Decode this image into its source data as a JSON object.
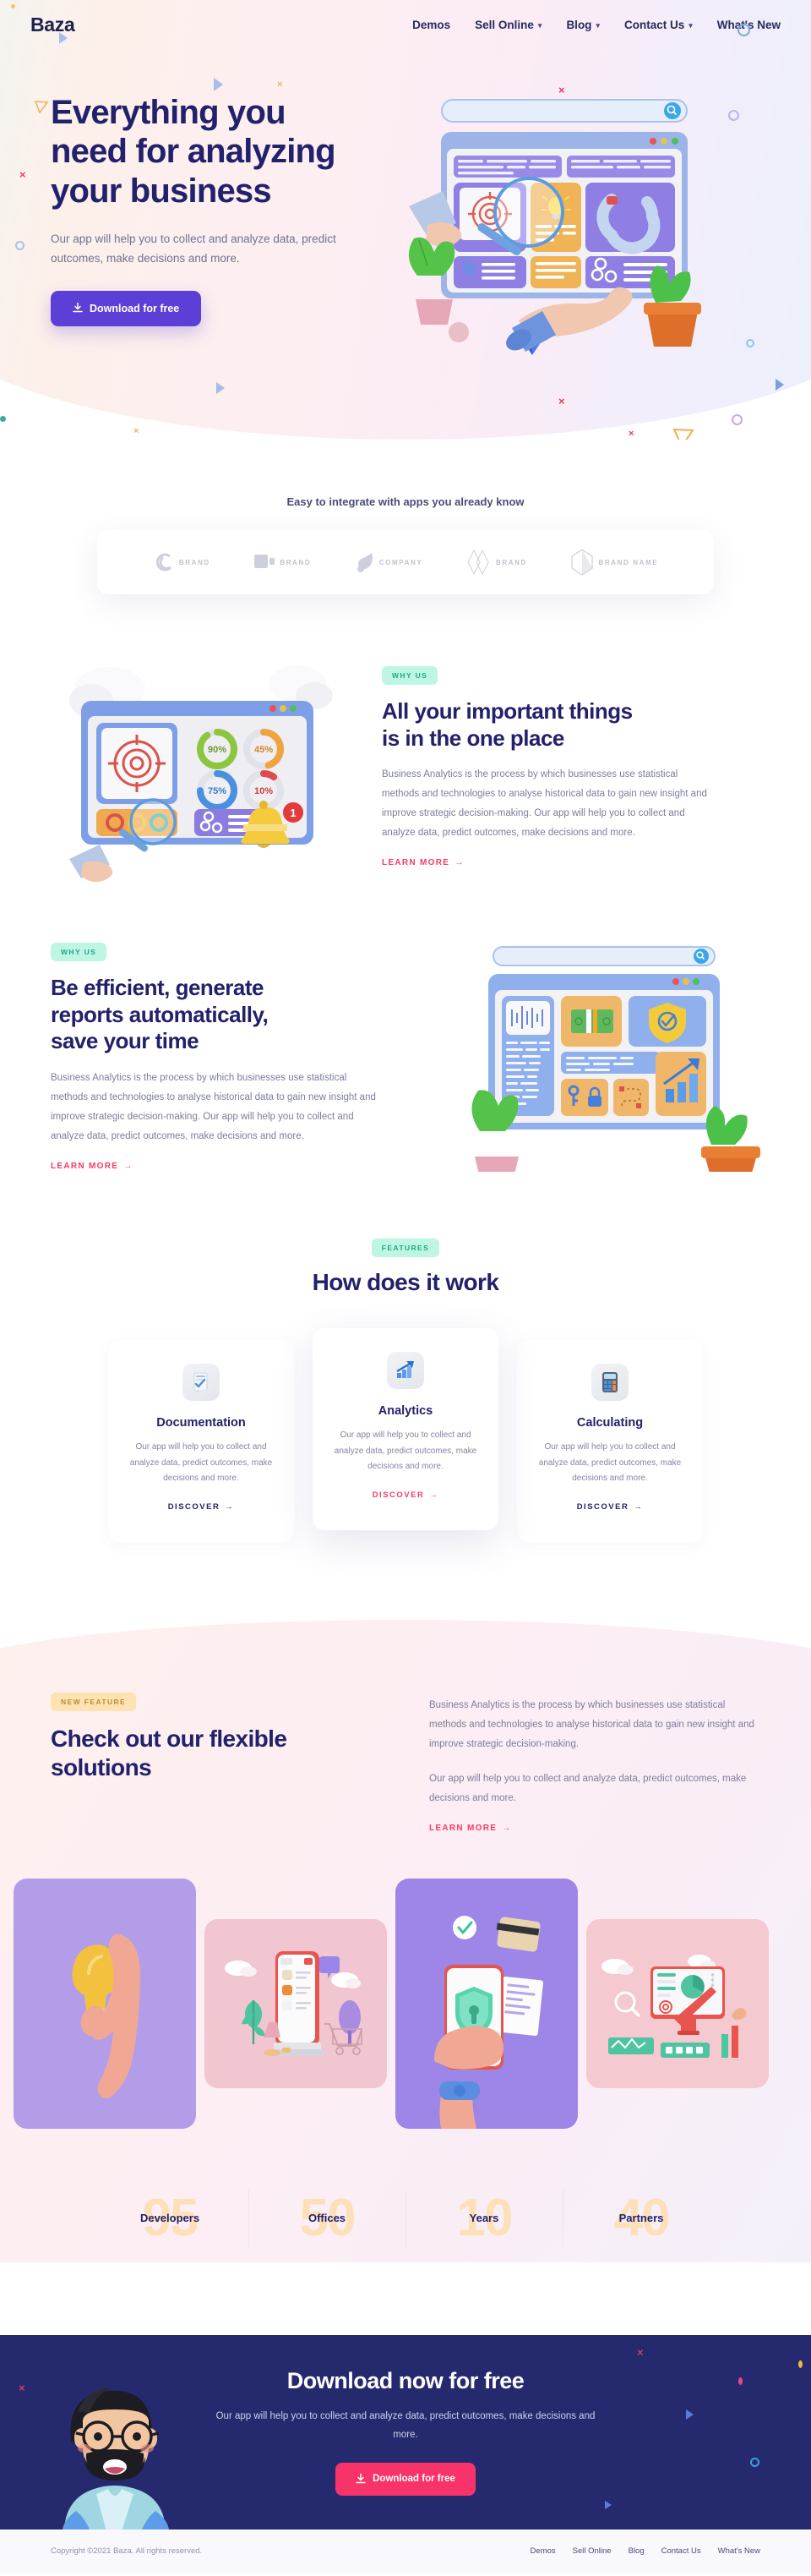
{
  "brand": "Baza",
  "nav": {
    "items": [
      {
        "label": "Demos",
        "dropdown": false
      },
      {
        "label": "Sell Online",
        "dropdown": true
      },
      {
        "label": "Blog",
        "dropdown": true
      },
      {
        "label": "Contact Us",
        "dropdown": true
      },
      {
        "label": "What's New",
        "dropdown": false
      }
    ]
  },
  "hero": {
    "title_line1": "Everything you",
    "title_line2": "need for analyzing",
    "title_line3": "your business",
    "subtitle": "Our app will help you to collect and analyze data, predict outcomes, make decisions and more.",
    "cta_label": "Download for free"
  },
  "logos": {
    "title": "Easy to integrate with apps you already know",
    "items": [
      {
        "name": "brand-swirl-logo",
        "text": "BRAND"
      },
      {
        "name": "brand-square-logo",
        "text": "BRAND"
      },
      {
        "name": "company-drop-logo",
        "text": "COMPANY"
      },
      {
        "name": "brand-diamond-logo",
        "text": "BRAND"
      },
      {
        "name": "brand-hex-logo",
        "text": "BRAND NAME"
      }
    ]
  },
  "section_one": {
    "pill": "WHY US",
    "title_line1": "All your important things",
    "title_line2": "is in the one place",
    "body": "Business Analytics is the process by which businesses use statistical methods and technologies to analyse historical data to gain new insight and improve strategic decision-making. Our app will help you to collect and analyze data, predict outcomes, make decisions and more.",
    "link": "LEARN MORE",
    "art_percentages": [
      "90%",
      "45%",
      "75%",
      "10%"
    ],
    "art_badge": "1"
  },
  "section_two": {
    "pill": "WHY US",
    "title_line1": "Be efficient, generate",
    "title_line2": "reports automatically,",
    "title_line3": "save your time",
    "body": "Business Analytics is the process by which businesses use statistical methods and technologies to analyse historical data to gain new insight and improve strategic decision-making. Our app will help you to collect and analyze data, predict outcomes, make decisions and more.",
    "link": "LEARN MORE"
  },
  "features": {
    "pill": "FEATURES",
    "title": "How does it work",
    "cards": [
      {
        "icon": "document-check-icon",
        "title": "Documentation",
        "body": "Our app will help you to collect and analyze data, predict outcomes, make decisions and more.",
        "link": "DISCOVER",
        "featured": false
      },
      {
        "icon": "growth-chart-icon",
        "title": "Analytics",
        "body": "Our app will help you to collect and analyze data, predict outcomes, make decisions and more.",
        "link": "DISCOVER",
        "featured": true
      },
      {
        "icon": "calculator-icon",
        "title": "Calculating",
        "body": "Our app will help you to collect and analyze data, predict outcomes, make decisions and more.",
        "link": "DISCOVER",
        "featured": false
      }
    ]
  },
  "solutions": {
    "pill": "NEW FEATURE",
    "title_line1": "Check out our flexible",
    "title_line2": "solutions",
    "paragraph1": "Business Analytics is the process by which businesses use statistical methods and technologies to analyse historical data to gain new insight and improve strategic decision-making.",
    "paragraph2": "Our app will help you to collect and analyze data, predict outcomes, make decisions and more.",
    "link": "LEARN MORE",
    "gallery": [
      {
        "name": "idea-lightbulb-card",
        "bg": "#b49de8",
        "tall": true
      },
      {
        "name": "mobile-shopping-card",
        "bg": "#f2c6d0",
        "tall": false
      },
      {
        "name": "secure-payment-card",
        "bg": "#9d86e8",
        "tall": true
      },
      {
        "name": "analytics-dashboard-card",
        "bg": "#f4c9cf",
        "tall": false
      }
    ]
  },
  "stats": [
    {
      "number": "95",
      "label": "Developers"
    },
    {
      "number": "50",
      "label": "Offices"
    },
    {
      "number": "10",
      "label": "Years"
    },
    {
      "number": "40",
      "label": "Partners"
    }
  ],
  "cta": {
    "title": "Download now for free",
    "subtitle": "Our app will help you to collect and analyze data, predict outcomes, make decisions and more.",
    "button": "Download for free"
  },
  "footer": {
    "copyright": "Copyright ©2021 Baza. All rights reserved.",
    "links": [
      "Demos",
      "Sell Online",
      "Blog",
      "Contact Us",
      "What's New"
    ]
  },
  "colors": {
    "primary": "#5b3fd6",
    "accent_pink": "#f43b63",
    "cta_pink": "#f8336a",
    "dark_navy": "#22216b",
    "cta_bg": "#252a6e",
    "teal_pill": "#bff6e3",
    "amber_pill": "#fde3b2",
    "stat_number": "#fde0b8"
  }
}
